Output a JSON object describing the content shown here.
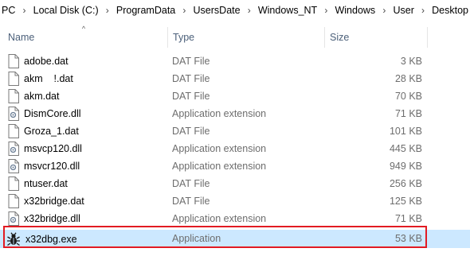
{
  "breadcrumb": {
    "items": [
      "PC",
      "Local Disk (C:)",
      "ProgramData",
      "UsersDate",
      "Windows_NT",
      "Windows",
      "User",
      "Desktop"
    ],
    "separator": "›"
  },
  "columns": {
    "name": "Name",
    "type": "Type",
    "size": "Size",
    "sort_indicator": "^"
  },
  "files": [
    {
      "name": "adobe.dat",
      "type": "DAT File",
      "size": "3 KB",
      "icon": "blank-file-icon"
    },
    {
      "name": "akm    !.dat",
      "type": "DAT File",
      "size": "28 KB",
      "icon": "blank-file-icon"
    },
    {
      "name": "akm.dat",
      "type": "DAT File",
      "size": "70 KB",
      "icon": "blank-file-icon"
    },
    {
      "name": "DismCore.dll",
      "type": "Application extension",
      "size": "71 KB",
      "icon": "dll-file-icon"
    },
    {
      "name": "Groza_1.dat",
      "type": "DAT File",
      "size": "101 KB",
      "icon": "blank-file-icon"
    },
    {
      "name": "msvcp120.dll",
      "type": "Application extension",
      "size": "445 KB",
      "icon": "dll-file-icon"
    },
    {
      "name": "msvcr120.dll",
      "type": "Application extension",
      "size": "949 KB",
      "icon": "dll-file-icon"
    },
    {
      "name": "ntuser.dat",
      "type": "DAT File",
      "size": "256 KB",
      "icon": "blank-file-icon"
    },
    {
      "name": "x32bridge.dat",
      "type": "DAT File",
      "size": "125 KB",
      "icon": "blank-file-icon"
    },
    {
      "name": "x32bridge.dll",
      "type": "Application extension",
      "size": "71 KB",
      "icon": "dll-file-icon"
    },
    {
      "name": "x32dbg.exe",
      "type": "Application",
      "size": "53 KB",
      "icon": "bug-icon",
      "selected": true
    }
  ],
  "colors": {
    "selection": "#cce8ff",
    "highlight_border": "#e21b23",
    "header_text": "#4c607a",
    "secondary_text": "#6d6d6d"
  }
}
